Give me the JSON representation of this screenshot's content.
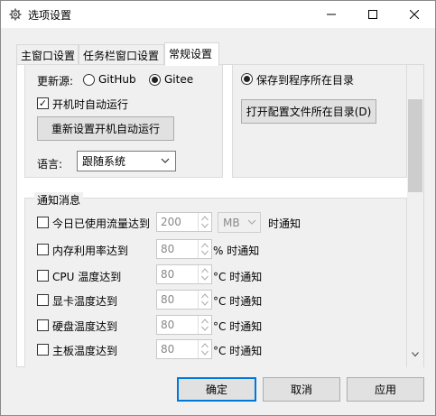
{
  "window": {
    "title": "选项设置",
    "icon": "gear-icon"
  },
  "tabs": [
    {
      "label": "主窗口设置",
      "active": false
    },
    {
      "label": "任务栏窗口设置",
      "active": false
    },
    {
      "label": "常规设置",
      "active": true
    }
  ],
  "update": {
    "label": "更新源:",
    "options": [
      {
        "label": "GitHub",
        "selected": false
      },
      {
        "label": "Gitee",
        "selected": true
      }
    ]
  },
  "autostart": {
    "label": "开机时自动运行",
    "checked": true,
    "reset_button": "重新设置开机自动运行"
  },
  "language": {
    "label": "语言:",
    "selected": "跟随系统"
  },
  "config": {
    "save_option": "保存到程序所在目录",
    "selected": true,
    "open_button": "打开配置文件所在目录(D)"
  },
  "notify": {
    "group_title": "通知消息",
    "traffic": {
      "label": "今日已使用流量达到",
      "value": "200",
      "unit": "MB",
      "suffix": "时通知"
    },
    "items": [
      {
        "label": "内存利用率达到",
        "value": "80",
        "suffix": "% 时通知"
      },
      {
        "label": "CPU 温度达到",
        "value": "80",
        "suffix": "°C 时通知"
      },
      {
        "label": "显卡温度达到",
        "value": "80",
        "suffix": "°C 时通知"
      },
      {
        "label": "硬盘温度达到",
        "value": "80",
        "suffix": "°C 时通知"
      },
      {
        "label": "主板温度达到",
        "value": "80",
        "suffix": "°C 时通知"
      }
    ]
  },
  "footer": {
    "ok": "确定",
    "cancel": "取消",
    "apply": "应用"
  },
  "colors": {
    "accent": "#0078d7"
  }
}
